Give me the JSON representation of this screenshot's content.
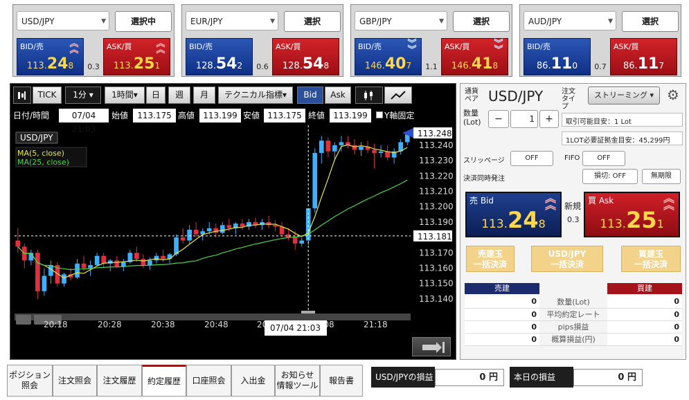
{
  "quotes": [
    {
      "pair": "USD/JPY",
      "button": "選択中",
      "bid_label": "BID/売",
      "ask_label": "ASK/買",
      "bid_small": "113.",
      "bid_big": "24",
      "bid_tail": "8",
      "ask_small": "113.",
      "ask_big": "25",
      "ask_tail": "1",
      "spread": "0.3",
      "direction": "up"
    },
    {
      "pair": "EUR/JPY",
      "button": "選択",
      "bid_label": "BID/売",
      "ask_label": "ASK/買",
      "bid_small": "128.",
      "bid_big": "54",
      "bid_tail": "2",
      "ask_small": "128.",
      "ask_big": "54",
      "ask_tail": "8",
      "spread": "0.6",
      "direction": "none"
    },
    {
      "pair": "GBP/JPY",
      "button": "選択",
      "bid_label": "BID/売",
      "ask_label": "ASK/買",
      "bid_small": "146.",
      "bid_big": "40",
      "bid_tail": "7",
      "ask_small": "146.",
      "ask_big": "41",
      "ask_tail": "8",
      "spread": "1.1",
      "direction": "down"
    },
    {
      "pair": "AUD/JPY",
      "button": "選択",
      "bid_label": "BID/売",
      "ask_label": "ASK/買",
      "bid_small": "86.",
      "bid_big": "11",
      "bid_tail": "0",
      "ask_small": "86.",
      "ask_big": "11",
      "ask_tail": "7",
      "spread": "0.7",
      "direction": "none"
    }
  ],
  "toolbar": {
    "tick": "TICK",
    "interval": "1分",
    "period": "1時間",
    "day": "日",
    "week": "週",
    "month": "月",
    "indicator": "テクニカル指標",
    "bid": "Bid",
    "ask": "Ask"
  },
  "info": {
    "datetime_label": "日付/時間",
    "datetime": "07/04 21:03",
    "open_label": "始値",
    "open": "113.175",
    "high_label": "高値",
    "high": "113.199",
    "low_label": "安値",
    "low": "113.175",
    "close_label": "終値",
    "close": "113.199",
    "fix_label": "Y軸固定"
  },
  "chart_data": {
    "type": "candlestick",
    "symbol_label": "USD/JPY",
    "indicators": [
      {
        "name": "MA(5, close)",
        "color": "#e8e84a"
      },
      {
        "name": "MA(25, close)",
        "color": "#4ad64a"
      }
    ],
    "y_ticks": [
      "113.248",
      "113.240",
      "113.230",
      "113.220",
      "113.210",
      "113.200",
      "113.190",
      "113.181",
      "113.170",
      "113.160",
      "113.150",
      "113.140"
    ],
    "ylim": [
      113.135,
      113.253
    ],
    "x_ticks": [
      "20:18",
      "20:28",
      "20:38",
      "20:48",
      "20:58",
      "21:08",
      "21:18"
    ],
    "current_price": "113.248",
    "crosshair_price": "113.181",
    "crosshair_time": "07/04 21:03",
    "up_color": "#3fb0ff",
    "down_color": "#e03040",
    "candles": [
      [
        113.178,
        113.186,
        113.17,
        113.174
      ],
      [
        113.174,
        113.176,
        113.16,
        113.165
      ],
      [
        113.165,
        113.172,
        113.162,
        113.17
      ],
      [
        113.17,
        113.172,
        113.14,
        113.145
      ],
      [
        113.145,
        113.16,
        113.142,
        113.155
      ],
      [
        113.155,
        113.165,
        113.15,
        113.162
      ],
      [
        113.162,
        113.164,
        113.148,
        113.15
      ],
      [
        113.15,
        113.157,
        113.148,
        113.156
      ],
      [
        113.156,
        113.16,
        113.152,
        113.154
      ],
      [
        113.154,
        113.166,
        113.153,
        113.163
      ],
      [
        113.163,
        113.168,
        113.158,
        113.16
      ],
      [
        113.16,
        113.165,
        113.155,
        113.162
      ],
      [
        113.162,
        113.17,
        113.161,
        113.168
      ],
      [
        113.168,
        113.17,
        113.16,
        113.163
      ],
      [
        113.163,
        113.166,
        113.158,
        113.165
      ],
      [
        113.165,
        113.168,
        113.16,
        113.161
      ],
      [
        113.161,
        113.166,
        113.158,
        113.164
      ],
      [
        113.164,
        113.172,
        113.163,
        113.17
      ],
      [
        113.17,
        113.174,
        113.164,
        113.166
      ],
      [
        113.166,
        113.169,
        113.16,
        113.162
      ],
      [
        113.162,
        113.167,
        113.159,
        113.165
      ],
      [
        113.165,
        113.17,
        113.163,
        113.168
      ],
      [
        113.168,
        113.172,
        113.164,
        113.166
      ],
      [
        113.166,
        113.17,
        113.163,
        113.169
      ],
      [
        113.169,
        113.182,
        113.168,
        113.18
      ],
      [
        113.18,
        113.186,
        113.176,
        113.178
      ],
      [
        113.178,
        113.188,
        113.176,
        113.185
      ],
      [
        113.185,
        113.19,
        113.18,
        113.182
      ],
      [
        113.182,
        113.186,
        113.178,
        113.184
      ],
      [
        113.184,
        113.19,
        113.182,
        113.186
      ],
      [
        113.186,
        113.189,
        113.18,
        113.183
      ],
      [
        113.183,
        113.19,
        113.182,
        113.188
      ],
      [
        113.188,
        113.192,
        113.184,
        113.186
      ],
      [
        113.186,
        113.19,
        113.182,
        113.189
      ],
      [
        113.189,
        113.192,
        113.185,
        113.187
      ],
      [
        113.187,
        113.192,
        113.185,
        113.19
      ],
      [
        113.19,
        113.193,
        113.186,
        113.188
      ],
      [
        113.188,
        113.192,
        113.185,
        113.19
      ],
      [
        113.19,
        113.194,
        113.186,
        113.188
      ],
      [
        113.188,
        113.191,
        113.184,
        113.187
      ],
      [
        113.187,
        113.19,
        113.18,
        113.182
      ],
      [
        113.182,
        113.186,
        113.178,
        113.18
      ],
      [
        113.18,
        113.184,
        113.172,
        113.176
      ],
      [
        113.176,
        113.18,
        113.174,
        113.178
      ],
      [
        113.178,
        113.199,
        113.175,
        113.199
      ],
      [
        113.199,
        113.238,
        113.196,
        113.235
      ],
      [
        113.235,
        113.246,
        113.228,
        113.243
      ],
      [
        113.243,
        113.245,
        113.232,
        113.236
      ],
      [
        113.236,
        113.242,
        113.23,
        113.24
      ],
      [
        113.24,
        113.246,
        113.236,
        113.242
      ],
      [
        113.242,
        113.246,
        113.238,
        113.24
      ],
      [
        113.24,
        113.244,
        113.234,
        113.237
      ],
      [
        113.237,
        113.242,
        113.233,
        113.239
      ],
      [
        113.239,
        113.243,
        113.235,
        113.237
      ],
      [
        113.237,
        113.241,
        113.225,
        113.235
      ],
      [
        113.235,
        113.24,
        113.232,
        113.236
      ],
      [
        113.236,
        113.24,
        113.23,
        113.232
      ],
      [
        113.232,
        113.238,
        113.228,
        113.236
      ],
      [
        113.236,
        113.244,
        113.234,
        113.242
      ],
      [
        113.242,
        113.248,
        113.24,
        113.247
      ]
    ]
  },
  "order": {
    "pair_label": "通貨ペア",
    "pair": "USD/JPY",
    "type_label": "注文タイプ",
    "type": "ストリーミング",
    "qty_label": "数量(Lot)",
    "qty": "1",
    "minus": "−",
    "plus": "+",
    "avail": "取引可能目安：1 Lot",
    "margin": "1LOT必要証拠金目安：45,299円",
    "slippage_label": "スリッページ",
    "slippage": "OFF",
    "fifo_label": "FIFO",
    "fifo": "OFF",
    "settle_label": "決済同時発注",
    "loss_cut": "損切: OFF",
    "unlimited": "無期限",
    "bid_label": "売 Bid",
    "ask_label": "買 Ask",
    "new_label": "新規",
    "spread": "0.3",
    "bid_small": "113.",
    "bid_big": "24",
    "bid_tail": "8",
    "ask_small": "113.",
    "ask_big": "25",
    "ask_tail": "1",
    "close_sell": "売建玉\n一括決済",
    "close_pair": "USD/JPY\n一括決済",
    "close_buy": "買建玉\n一括決済",
    "sell_head": "売建",
    "buy_head": "買建",
    "rows": [
      {
        "label": "数量(Lot)",
        "sell": "0",
        "buy": "0"
      },
      {
        "label": "平均約定レート",
        "sell": "0",
        "buy": "0"
      },
      {
        "label": "pips損益",
        "sell": "0",
        "buy": "0"
      },
      {
        "label": "概算損益(円)",
        "sell": "0",
        "buy": "0"
      }
    ]
  },
  "tabs": [
    "ポジション\n照会",
    "注文照会",
    "注文履歴",
    "約定履歴",
    "口座照会",
    "入出金",
    "お知らせ\n情報ツール",
    "報告書"
  ],
  "active_tab": 3,
  "pl": {
    "pair_label": "USD/JPYの損益",
    "pair_value": "0 円",
    "today_label": "本日の損益",
    "today_value": "0 円"
  }
}
